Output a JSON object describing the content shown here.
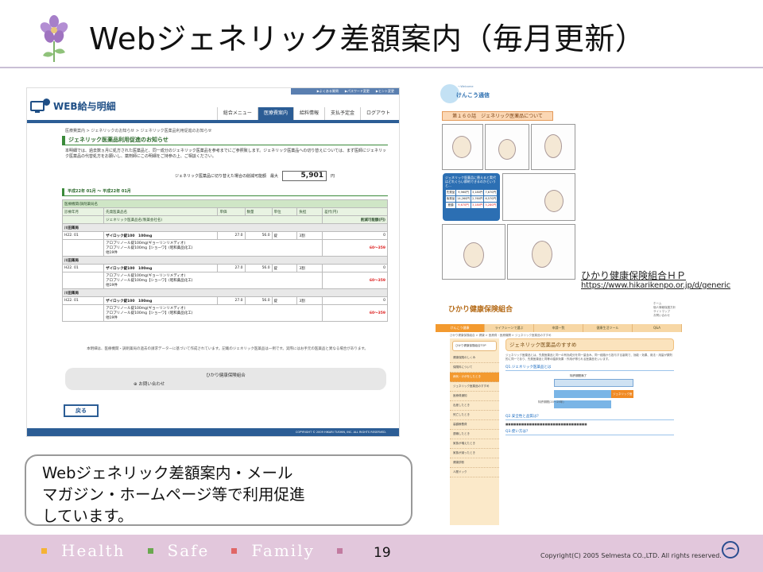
{
  "slide": {
    "title": "Webジェネリック差額案内（毎月更新）",
    "callout_lines": [
      "Webジェネリック差額案内・メール",
      "マガジン・ホームページ等で利用促進",
      "しています。"
    ],
    "link_label": "ひかり健康保険組合ＨＰ",
    "link_url": "https://www.hikarikenpo.or.jp/d/generic",
    "page_number": "19",
    "copyright": "Copyright(C) 2005 Selmesta CO.,LTD.  All rights reserved.",
    "footer_tags": [
      "Health",
      "Safe",
      "Family"
    ],
    "footer_tag_colors": [
      "#f5b335",
      "#6aa84f",
      "#e06666",
      "#c27ba0"
    ]
  },
  "web_payslip": {
    "top_links": [
      "▶よくある質問",
      "▶パスワード変更",
      "▶ヒント変更"
    ],
    "logo_text": "WEB給与明細",
    "nav": [
      "総合メニュー",
      "医療費案内",
      "給料情報",
      "支払予定金",
      "ログアウト"
    ],
    "active_nav": "医療費案内",
    "breadcrumb": "医療費案内 > ジェネリックのお知らせ > ジェネリック医薬品利用促進のお知らせ",
    "heading": "ジェネリック医薬品利用促進のお知らせ",
    "intro": "本明細では、過去数ヵ月に処方された医薬品と、同一成分のジェネリック医薬品を参考までにご参照致します。ジェネリック医薬品への切り替えについては、まず医師にジェネリック医薬品の代替処方をお願いし、薬剤師にこの明細をご持参の上、ご相談ください。",
    "amount_label": "ジェネリック医薬品に切り替えた場合の削減可能額　最大",
    "amount_value": "5,901",
    "amount_unit": "円",
    "period": "平成22年 01月 〜 平成22年 01月",
    "table_header1": [
      "医療機関/調剤薬局名"
    ],
    "table_header2": [
      "診療年月",
      "先発医薬品名",
      "単価",
      "数量",
      "単位",
      "負担",
      "差代(円)"
    ],
    "table_header3": [
      "ジェネリック医薬品名(製薬会社名)",
      "削減可能額(円)"
    ],
    "rows": [
      {
        "pharmacy": "川田薬局",
        "month": "H22. 01",
        "drug": "ザイロック錠100　100mg",
        "price": "27.0",
        "qty": "56.0",
        "unit": "錠",
        "burden": "3割",
        "diff": "0",
        "generics": [
          "アロプリノール錠100mg(ギョーリンリメディオ)",
          "アロプリノール錠100mg【ショーワ】(昭和薬品化工)",
          "他19件"
        ],
        "saving": "60〜359"
      },
      {
        "pharmacy": "川田薬局",
        "month": "H22. 01",
        "drug": "ザイロック錠100　100mg",
        "price": "27.0",
        "qty": "56.0",
        "unit": "錠",
        "burden": "3割",
        "diff": "0",
        "generics": [
          "アロプリノール錠100mg(ギョーリンリメディオ)",
          "アロプリノール錠100mg【ショーワ】(昭和薬品化工)",
          "他19件"
        ],
        "saving": "60〜359"
      },
      {
        "pharmacy": "川田薬局",
        "month": "H22. 01",
        "drug": "ザイロック錠100　100mg",
        "price": "27.0",
        "qty": "56.0",
        "unit": "錠",
        "burden": "3割",
        "diff": "0",
        "generics": [
          "アロプリノール錠100mg(ギョーリンリメディオ)",
          "アロプリノール錠100mg【ショーワ】(昭和薬品化工)",
          "他19件"
        ],
        "saving": "60〜359"
      }
    ],
    "note": "本明細は、医療機関・調剤薬局の過去の請求データーに基づいて作成されています。記載のジェネリック医薬品は一例です。実際にはお手元の医薬品と異なる場合があります。",
    "contact_union": "ひかり健康保険組合",
    "contact_link": "お問い合わせ",
    "back_button": "戻る",
    "footer": "COPYRIGHT © 2009 HIKARI TUSHIN, INC. ALL RIGHTS RESERVED."
  },
  "newsletter": {
    "tag": "〜Welcome",
    "title": "けんこう通信",
    "banner": "第１６０話　ジェネリック医薬品について",
    "graph_title": "ジェネリック医薬品に替えると実代はどれくらい節約できるのかというと…",
    "graph_rows": [
      [
        "先発品",
        "9,960円",
        "3,180円",
        "7,670円"
      ],
      [
        "後発品",
        "14,260円",
        "2,760円",
        "6,570円"
      ],
      [
        "差額",
        "9,670円",
        "3,180円",
        "5,280円"
      ]
    ]
  },
  "hikari_site": {
    "logo": "ひかり健康保険組合",
    "contact": [
      "ホーム",
      "個人情報保護方針",
      "サイトマップ",
      "お問い合わせ"
    ],
    "nav": [
      "けんこう健康",
      "ライフシーンで選ぶ",
      "申請一覧",
      "健康生活ツール",
      "Q&A"
    ],
    "active_nav": "けんこう健康",
    "breadcrumb": "ひかり健康保険組合 > 健康 > 医療費・医療機関 > ジェネリック医薬品のすすめ",
    "side_items": [
      "ひかり健康保険組合TOP",
      "健康保険のしくみ",
      "保険料について",
      "病気・けがをしたとき",
      "ジェネリック医薬品のすすめ",
      "医療費通知",
      "出産したとき",
      "死亡したとき",
      "高額療養費",
      "退職したとき",
      "家族が増えたとき",
      "家族が減ったとき",
      "健康診断",
      "人間ドック"
    ],
    "heading": "ジェネリック医薬品のすすめ",
    "intro": "ジェネリック医薬品とは、先発医薬品と同一の有効成分を同一量含み、同一経路から投与する製剤で、効能・効果、用法・用量が原則的に同一であり、先発医薬品と同等の臨床効果・作用が得られる医薬品をいいます。",
    "q1": "Q1.ジェネリック医薬品とは",
    "diag_label": "特許期間満了",
    "diag_bar": "ジェネリック医薬品",
    "diag_period": "特許期間(20〜25年)",
    "q2": "Q2.安全性と品質は？",
    "q3": "Q3.使い方は？"
  }
}
